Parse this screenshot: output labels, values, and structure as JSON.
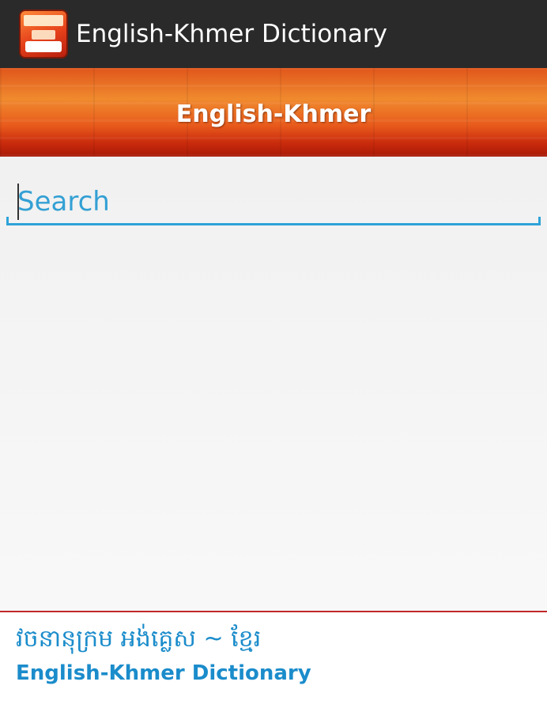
{
  "action_bar": {
    "app_icon": "dictionary-app-icon",
    "title": "English-Khmer Dictionary"
  },
  "banner": {
    "title": "English-Khmer"
  },
  "search": {
    "placeholder": "Search",
    "value": ""
  },
  "footer": {
    "khmer_title": "វចនានុក្រម អង់គ្លេស ~ ខ្មែរ",
    "english_title": "English-Khmer Dictionary"
  },
  "colors": {
    "action_bar_bg": "#2a2a2a",
    "accent_blue": "#2ea3d9",
    "divider_red": "#c0282a",
    "banner_orange": "#e85a1c"
  }
}
